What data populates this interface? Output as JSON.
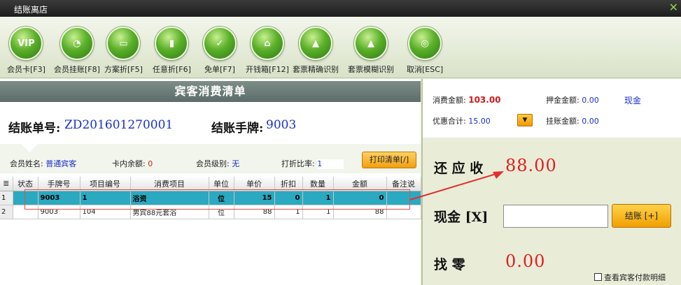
{
  "window": {
    "title": "结账离店"
  },
  "toolbar": [
    {
      "label": "会员卡[F3]",
      "icon": "vip-icon",
      "glyph": "VIP"
    },
    {
      "label": "会员挂账[F8]",
      "icon": "member-charge-icon",
      "glyph": "◔"
    },
    {
      "label": "方案折[F5]",
      "icon": "plan-discount-icon",
      "glyph": "▭"
    },
    {
      "label": "任意折[F6]",
      "icon": "any-discount-icon",
      "glyph": "▮"
    },
    {
      "label": "免单[F7]",
      "icon": "free-order-icon",
      "glyph": "✓"
    },
    {
      "label": "开钱箱[F12]",
      "icon": "cash-drawer-icon",
      "glyph": "⌂"
    },
    {
      "label": "套票精确识别",
      "icon": "ticket-exact-icon",
      "glyph": "▲"
    },
    {
      "label": "套票模糊识别",
      "icon": "ticket-fuzzy-icon",
      "glyph": "▲"
    },
    {
      "label": "取消[ESC]",
      "icon": "cancel-icon",
      "glyph": "◎"
    }
  ],
  "bill": {
    "section_title": "宾客消费清单",
    "no_label": "结账单号:",
    "no_value": "ZD201601270001",
    "tag_label": "结账手牌:",
    "tag_value": "9003"
  },
  "member": {
    "name_label": "会员姓名:",
    "name_value": "普通宾客",
    "balance_label": "卡内余额:",
    "balance_value": "0",
    "level_label": "会员级别:",
    "level_value": "无",
    "rate_label": "打折比率:",
    "rate_value": "1",
    "print_button": "打印清单[/]"
  },
  "grid": {
    "columns": [
      "状态",
      "手牌号",
      "项目编号",
      "消费项目",
      "单位",
      "单价",
      "折扣",
      "数量",
      "金额",
      "备注说"
    ],
    "rows": [
      {
        "rownum": "1",
        "status": "",
        "tag": "9003",
        "code": "1",
        "item": "浴资",
        "unit": "位",
        "price": "15",
        "discount": "0",
        "qty": "1",
        "amount": "0",
        "note": ""
      },
      {
        "rownum": "2",
        "status": "",
        "tag": "9003",
        "code": "104",
        "item": "男宾88元套浴",
        "unit": "位",
        "price": "88",
        "discount": "1",
        "qty": "1",
        "amount": "88",
        "note": ""
      }
    ]
  },
  "summary": {
    "consume_label": "消费金额:",
    "consume_value": "103.00",
    "deposit_label": "押金金额:",
    "deposit_value": "0.00",
    "deposit_method": "现金",
    "discount_label": "优惠合计:",
    "discount_value": "15.00",
    "charge_label": "挂账金额:",
    "charge_value": "0.00",
    "due_label": "还 应 收",
    "due_value": "88.00",
    "cash_label": "现金 [X]",
    "cash_value": "",
    "settle_button": "结账 [+]",
    "change_label": "找    零",
    "change_value": "0.00",
    "detail_checkbox": "查看宾客付款明细"
  },
  "colors": {
    "accent_red": "#e02020",
    "selected_row": "#2aa9c0",
    "value_blue": "#1a2fc8",
    "button_orange": "#f0a000"
  }
}
